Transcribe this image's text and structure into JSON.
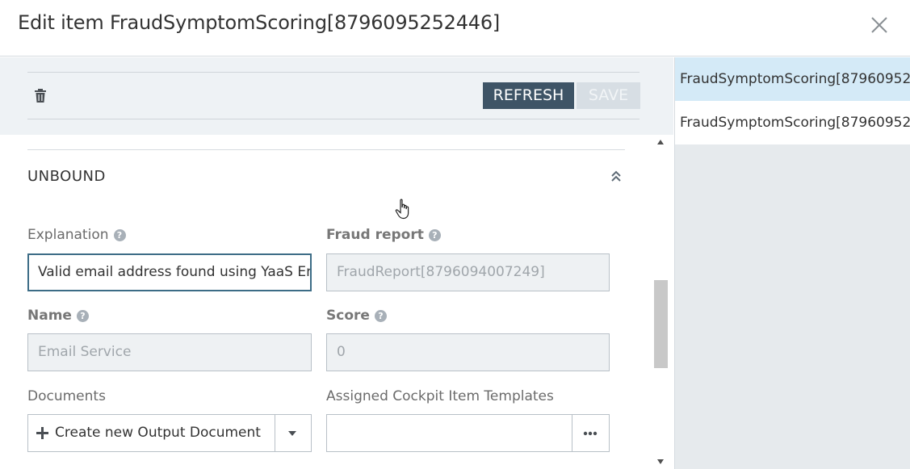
{
  "header": {
    "title": "Edit item FraudSymptomScoring[8796095252446]",
    "close_icon": "close-icon"
  },
  "toolbar": {
    "delete_icon": "trash-icon",
    "refresh_label": "REFRESH",
    "save_label": "SAVE"
  },
  "section": {
    "title": "UNBOUND",
    "collapse_icon": "double-chevron-up-icon"
  },
  "fields": {
    "explanation": {
      "label": "Explanation",
      "value": "Valid email address found using YaaS Email Service"
    },
    "fraud_report": {
      "label": "Fraud report",
      "value": "FraudReport[8796094007249]"
    },
    "name": {
      "label": "Name",
      "value": "Email Service"
    },
    "score": {
      "label": "Score",
      "value": "0"
    },
    "documents": {
      "label": "Documents",
      "create_label": "Create new Output Document"
    },
    "templates": {
      "label": "Assigned Cockpit Item Templates",
      "value": ""
    }
  },
  "side_list": {
    "items": [
      {
        "label": "FraudSymptomScoring[87960952..."
      },
      {
        "label": "FraudSymptomScoring[87960952..."
      }
    ]
  },
  "colors": {
    "primary_button": "#3e5466",
    "disabled_button": "#d7dee4",
    "selected_item": "#d4eaf7",
    "active_border": "#3c6c86"
  }
}
